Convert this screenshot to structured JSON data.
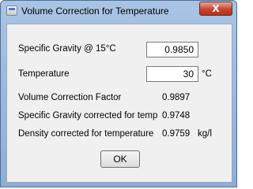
{
  "window": {
    "title": "Volume Correction for Temperature",
    "close_glyph": "X"
  },
  "form": {
    "specific_gravity_label": "Specific Gravity @ 15°C",
    "specific_gravity_value": "0.9850",
    "temperature_label": "Temperature",
    "temperature_value": "30",
    "temperature_unit": "°C"
  },
  "results": {
    "vcf_label": "Volume Correction Factor",
    "vcf_value": "0.9897",
    "sg_corrected_label": "Specific Gravity corrected for temp",
    "sg_corrected_value": "0.9748",
    "density_label": "Density corrected for temperature",
    "density_value": "0.9759",
    "density_unit": "kg/l"
  },
  "buttons": {
    "ok_label": "OK"
  }
}
